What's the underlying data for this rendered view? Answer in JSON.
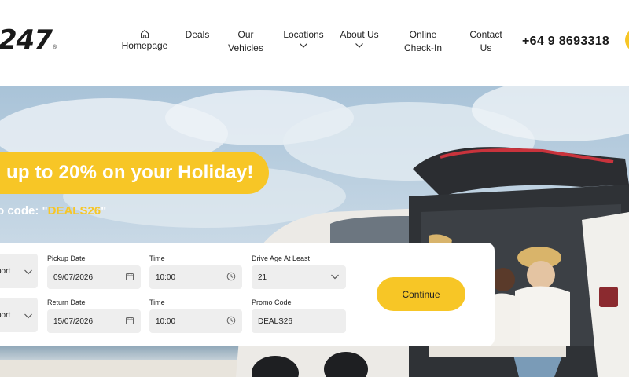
{
  "brand": {
    "logo_text": "247",
    "logo_mark": "®"
  },
  "nav": {
    "home": "Homepage",
    "deals": "Deals",
    "vehicles_1": "Our",
    "vehicles_2": "Vehicles",
    "locations": "Locations",
    "about": "About Us",
    "checkin_1": "Online",
    "checkin_2": "Check-In",
    "contact_1": "Contact",
    "contact_2": "Us"
  },
  "phone": "+64 9 8693318",
  "hero": {
    "headline": "up to 20% on your Holiday!",
    "promo_prefix": "o code: \"",
    "promo_code": "DEALS26",
    "promo_suffix": "\""
  },
  "form": {
    "pickup_location_value": "port",
    "return_location_value": "port",
    "pickup_date_label": "Pickup Date",
    "pickup_date_value": "09/07/2026",
    "pickup_time_label": "Time",
    "pickup_time_value": "10:00",
    "return_date_label": "Return Date",
    "return_date_value": "15/07/2026",
    "return_time_label": "Time",
    "return_time_value": "10:00",
    "driver_age_label": "Drive Age At Least",
    "driver_age_value": "21",
    "promo_label": "Promo Code",
    "promo_value": "DEALS26",
    "continue_label": "Continue"
  },
  "colors": {
    "accent": "#f7c626",
    "field_bg": "#eeeeee",
    "sky": "#bcd0e0"
  },
  "icons": [
    "home-icon",
    "chevron-down-icon",
    "calendar-icon",
    "clock-icon"
  ]
}
